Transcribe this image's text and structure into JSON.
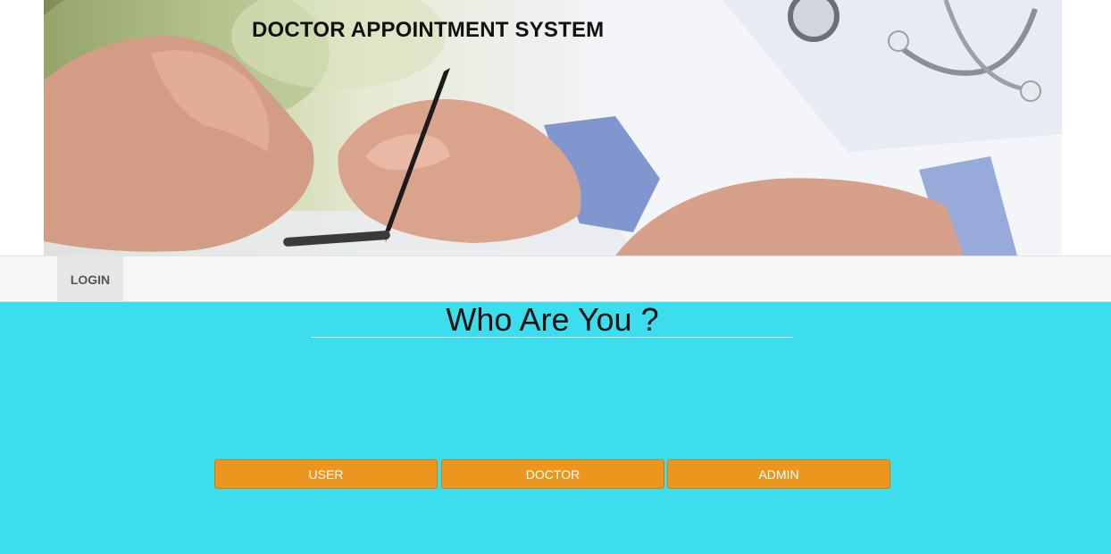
{
  "banner": {
    "title": "DOCTOR APPOINTMENT SYSTEM",
    "image": "doctor-writing-with-pen-photo"
  },
  "nav": {
    "items": [
      {
        "label": "LOGIN"
      }
    ]
  },
  "main": {
    "heading": "Who Are You ?",
    "buttons": [
      {
        "label": "USER"
      },
      {
        "label": "DOCTOR"
      },
      {
        "label": "ADMIN"
      }
    ]
  },
  "colors": {
    "main_background": "#3cdded",
    "button_background": "#eb961f",
    "navbar_background": "#f7f7f7",
    "nav_active_background": "#e7e7e7"
  }
}
